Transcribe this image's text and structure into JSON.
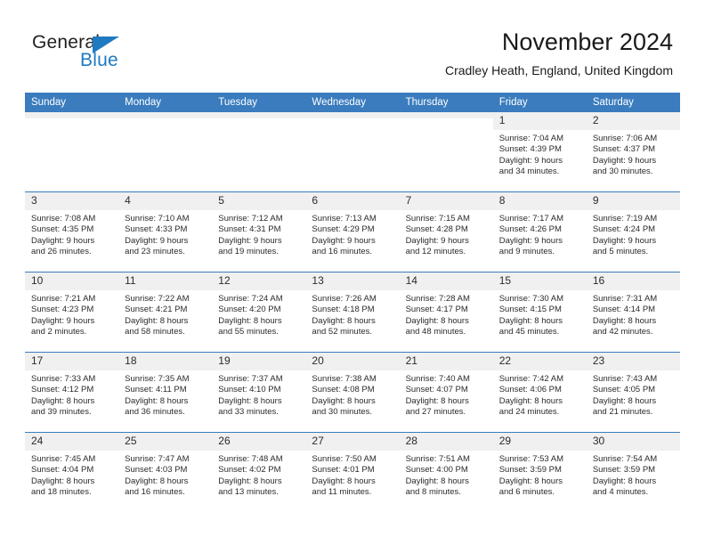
{
  "brand": {
    "name_part1": "General",
    "name_part2": "Blue",
    "logo_icon": "triangle-logo-icon",
    "accent_color": "#1f7ac0"
  },
  "header": {
    "title": "November 2024",
    "location": "Cradley Heath, England, United Kingdom"
  },
  "calendar": {
    "header_bg": "#3a7cbe",
    "daynum_bg": "#f0f0f0",
    "weekday_headers": [
      "Sunday",
      "Monday",
      "Tuesday",
      "Wednesday",
      "Thursday",
      "Friday",
      "Saturday"
    ],
    "weeks": [
      [
        {
          "day": "",
          "empty": true
        },
        {
          "day": "",
          "empty": true
        },
        {
          "day": "",
          "empty": true
        },
        {
          "day": "",
          "empty": true
        },
        {
          "day": "",
          "empty": true
        },
        {
          "day": "1",
          "sunrise": "Sunrise: 7:04 AM",
          "sunset": "Sunset: 4:39 PM",
          "daylight_line1": "Daylight: 9 hours",
          "daylight_line2": "and 34 minutes."
        },
        {
          "day": "2",
          "sunrise": "Sunrise: 7:06 AM",
          "sunset": "Sunset: 4:37 PM",
          "daylight_line1": "Daylight: 9 hours",
          "daylight_line2": "and 30 minutes."
        }
      ],
      [
        {
          "day": "3",
          "sunrise": "Sunrise: 7:08 AM",
          "sunset": "Sunset: 4:35 PM",
          "daylight_line1": "Daylight: 9 hours",
          "daylight_line2": "and 26 minutes."
        },
        {
          "day": "4",
          "sunrise": "Sunrise: 7:10 AM",
          "sunset": "Sunset: 4:33 PM",
          "daylight_line1": "Daylight: 9 hours",
          "daylight_line2": "and 23 minutes."
        },
        {
          "day": "5",
          "sunrise": "Sunrise: 7:12 AM",
          "sunset": "Sunset: 4:31 PM",
          "daylight_line1": "Daylight: 9 hours",
          "daylight_line2": "and 19 minutes."
        },
        {
          "day": "6",
          "sunrise": "Sunrise: 7:13 AM",
          "sunset": "Sunset: 4:29 PM",
          "daylight_line1": "Daylight: 9 hours",
          "daylight_line2": "and 16 minutes."
        },
        {
          "day": "7",
          "sunrise": "Sunrise: 7:15 AM",
          "sunset": "Sunset: 4:28 PM",
          "daylight_line1": "Daylight: 9 hours",
          "daylight_line2": "and 12 minutes."
        },
        {
          "day": "8",
          "sunrise": "Sunrise: 7:17 AM",
          "sunset": "Sunset: 4:26 PM",
          "daylight_line1": "Daylight: 9 hours",
          "daylight_line2": "and 9 minutes."
        },
        {
          "day": "9",
          "sunrise": "Sunrise: 7:19 AM",
          "sunset": "Sunset: 4:24 PM",
          "daylight_line1": "Daylight: 9 hours",
          "daylight_line2": "and 5 minutes."
        }
      ],
      [
        {
          "day": "10",
          "sunrise": "Sunrise: 7:21 AM",
          "sunset": "Sunset: 4:23 PM",
          "daylight_line1": "Daylight: 9 hours",
          "daylight_line2": "and 2 minutes."
        },
        {
          "day": "11",
          "sunrise": "Sunrise: 7:22 AM",
          "sunset": "Sunset: 4:21 PM",
          "daylight_line1": "Daylight: 8 hours",
          "daylight_line2": "and 58 minutes."
        },
        {
          "day": "12",
          "sunrise": "Sunrise: 7:24 AM",
          "sunset": "Sunset: 4:20 PM",
          "daylight_line1": "Daylight: 8 hours",
          "daylight_line2": "and 55 minutes."
        },
        {
          "day": "13",
          "sunrise": "Sunrise: 7:26 AM",
          "sunset": "Sunset: 4:18 PM",
          "daylight_line1": "Daylight: 8 hours",
          "daylight_line2": "and 52 minutes."
        },
        {
          "day": "14",
          "sunrise": "Sunrise: 7:28 AM",
          "sunset": "Sunset: 4:17 PM",
          "daylight_line1": "Daylight: 8 hours",
          "daylight_line2": "and 48 minutes."
        },
        {
          "day": "15",
          "sunrise": "Sunrise: 7:30 AM",
          "sunset": "Sunset: 4:15 PM",
          "daylight_line1": "Daylight: 8 hours",
          "daylight_line2": "and 45 minutes."
        },
        {
          "day": "16",
          "sunrise": "Sunrise: 7:31 AM",
          "sunset": "Sunset: 4:14 PM",
          "daylight_line1": "Daylight: 8 hours",
          "daylight_line2": "and 42 minutes."
        }
      ],
      [
        {
          "day": "17",
          "sunrise": "Sunrise: 7:33 AM",
          "sunset": "Sunset: 4:12 PM",
          "daylight_line1": "Daylight: 8 hours",
          "daylight_line2": "and 39 minutes."
        },
        {
          "day": "18",
          "sunrise": "Sunrise: 7:35 AM",
          "sunset": "Sunset: 4:11 PM",
          "daylight_line1": "Daylight: 8 hours",
          "daylight_line2": "and 36 minutes."
        },
        {
          "day": "19",
          "sunrise": "Sunrise: 7:37 AM",
          "sunset": "Sunset: 4:10 PM",
          "daylight_line1": "Daylight: 8 hours",
          "daylight_line2": "and 33 minutes."
        },
        {
          "day": "20",
          "sunrise": "Sunrise: 7:38 AM",
          "sunset": "Sunset: 4:08 PM",
          "daylight_line1": "Daylight: 8 hours",
          "daylight_line2": "and 30 minutes."
        },
        {
          "day": "21",
          "sunrise": "Sunrise: 7:40 AM",
          "sunset": "Sunset: 4:07 PM",
          "daylight_line1": "Daylight: 8 hours",
          "daylight_line2": "and 27 minutes."
        },
        {
          "day": "22",
          "sunrise": "Sunrise: 7:42 AM",
          "sunset": "Sunset: 4:06 PM",
          "daylight_line1": "Daylight: 8 hours",
          "daylight_line2": "and 24 minutes."
        },
        {
          "day": "23",
          "sunrise": "Sunrise: 7:43 AM",
          "sunset": "Sunset: 4:05 PM",
          "daylight_line1": "Daylight: 8 hours",
          "daylight_line2": "and 21 minutes."
        }
      ],
      [
        {
          "day": "24",
          "sunrise": "Sunrise: 7:45 AM",
          "sunset": "Sunset: 4:04 PM",
          "daylight_line1": "Daylight: 8 hours",
          "daylight_line2": "and 18 minutes."
        },
        {
          "day": "25",
          "sunrise": "Sunrise: 7:47 AM",
          "sunset": "Sunset: 4:03 PM",
          "daylight_line1": "Daylight: 8 hours",
          "daylight_line2": "and 16 minutes."
        },
        {
          "day": "26",
          "sunrise": "Sunrise: 7:48 AM",
          "sunset": "Sunset: 4:02 PM",
          "daylight_line1": "Daylight: 8 hours",
          "daylight_line2": "and 13 minutes."
        },
        {
          "day": "27",
          "sunrise": "Sunrise: 7:50 AM",
          "sunset": "Sunset: 4:01 PM",
          "daylight_line1": "Daylight: 8 hours",
          "daylight_line2": "and 11 minutes."
        },
        {
          "day": "28",
          "sunrise": "Sunrise: 7:51 AM",
          "sunset": "Sunset: 4:00 PM",
          "daylight_line1": "Daylight: 8 hours",
          "daylight_line2": "and 8 minutes."
        },
        {
          "day": "29",
          "sunrise": "Sunrise: 7:53 AM",
          "sunset": "Sunset: 3:59 PM",
          "daylight_line1": "Daylight: 8 hours",
          "daylight_line2": "and 6 minutes."
        },
        {
          "day": "30",
          "sunrise": "Sunrise: 7:54 AM",
          "sunset": "Sunset: 3:59 PM",
          "daylight_line1": "Daylight: 8 hours",
          "daylight_line2": "and 4 minutes."
        }
      ]
    ]
  }
}
